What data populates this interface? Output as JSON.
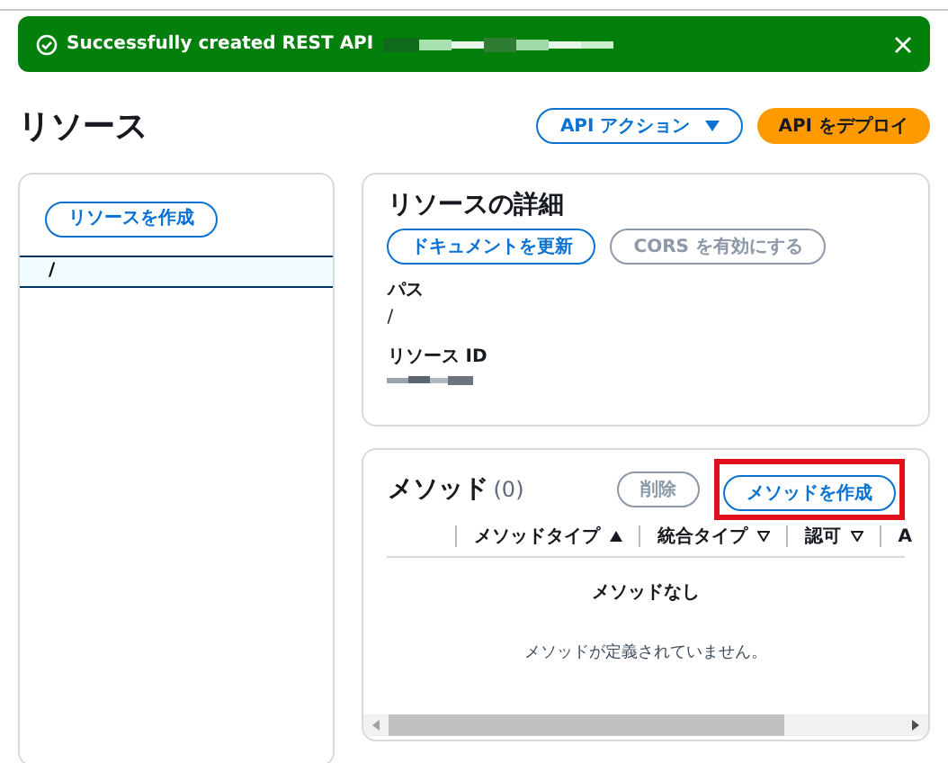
{
  "flash": {
    "message": "Successfully created REST API"
  },
  "header": {
    "title": "リソース",
    "actions": [
      {
        "label": "API アクション",
        "kind": "dropdown"
      },
      {
        "label": "API をデプロイ",
        "kind": "primary"
      }
    ]
  },
  "resources": {
    "create_button": "リソースを作成",
    "tree": [
      {
        "label": "/",
        "selected": true
      }
    ]
  },
  "details": {
    "title": "リソースの詳細",
    "buttons": [
      {
        "label": "ドキュメントを更新",
        "disabled": false
      },
      {
        "label": "CORS を有効にする",
        "disabled": true
      }
    ],
    "fields": [
      {
        "label": "パス",
        "value": "/",
        "kind": "text"
      },
      {
        "label": "リソース ID",
        "kind": "redacted"
      }
    ]
  },
  "methods": {
    "title": "メソッド",
    "count": "(0)",
    "buttons": [
      {
        "label": "削除",
        "disabled": true,
        "highlighted": false
      },
      {
        "label": "メソッドを作成",
        "disabled": false,
        "highlighted": true
      }
    ],
    "columns": [
      {
        "label": "メソッドタイプ",
        "kind": "sorted"
      },
      {
        "label": "統合タイプ",
        "kind": "sortable"
      },
      {
        "label": "認可",
        "kind": "sortable"
      },
      {
        "label": "A",
        "kind": "cut"
      }
    ],
    "empty_title": "メソッドなし",
    "empty_text": "メソッドが定義されていません。"
  }
}
